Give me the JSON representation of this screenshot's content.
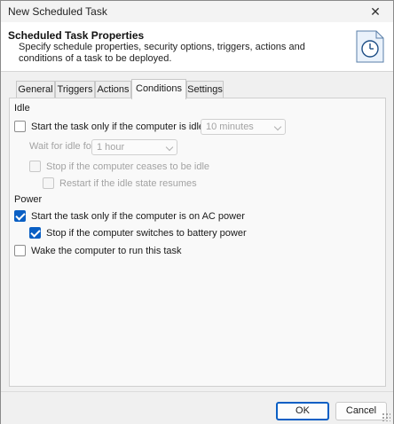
{
  "window": {
    "title": "New Scheduled Task",
    "close_symbol": "✕"
  },
  "banner": {
    "title": "Scheduled Task Properties",
    "description": "Specify schedule properties, security options, triggers, actions and conditions of a task to be deployed.",
    "icon": "clock-icon"
  },
  "tabs": [
    {
      "label": "General",
      "active": false
    },
    {
      "label": "Triggers",
      "active": false
    },
    {
      "label": "Actions",
      "active": false
    },
    {
      "label": "Conditions",
      "active": true
    },
    {
      "label": "Settings",
      "active": false
    }
  ],
  "conditions": {
    "idle": {
      "section_label": "Idle",
      "start_if_idle": {
        "label": "Start the task only if the computer is idle for:",
        "checked": false,
        "enabled": true
      },
      "idle_duration": {
        "value": "10 minutes",
        "enabled": false
      },
      "wait_for_idle_label": "Wait for idle for:",
      "wait_duration": {
        "value": "1 hour",
        "enabled": false
      },
      "stop_if_not_idle": {
        "label": "Stop if the computer ceases to be idle",
        "checked": false,
        "enabled": false
      },
      "restart_if_idle": {
        "label": "Restart if the idle state resumes",
        "checked": false,
        "enabled": false
      }
    },
    "power": {
      "section_label": "Power",
      "ac_power": {
        "label": "Start the task only if the computer is on AC power",
        "checked": true,
        "enabled": true
      },
      "stop_on_battery": {
        "label": "Stop if the computer switches to battery power",
        "checked": true,
        "enabled": true
      },
      "wake_to_run": {
        "label": "Wake the computer to run this task",
        "checked": false,
        "enabled": true
      }
    }
  },
  "buttons": {
    "ok": "OK",
    "cancel": "Cancel"
  },
  "colors": {
    "accent": "#0a5fc4",
    "disabled_text": "#a3a3a3"
  }
}
